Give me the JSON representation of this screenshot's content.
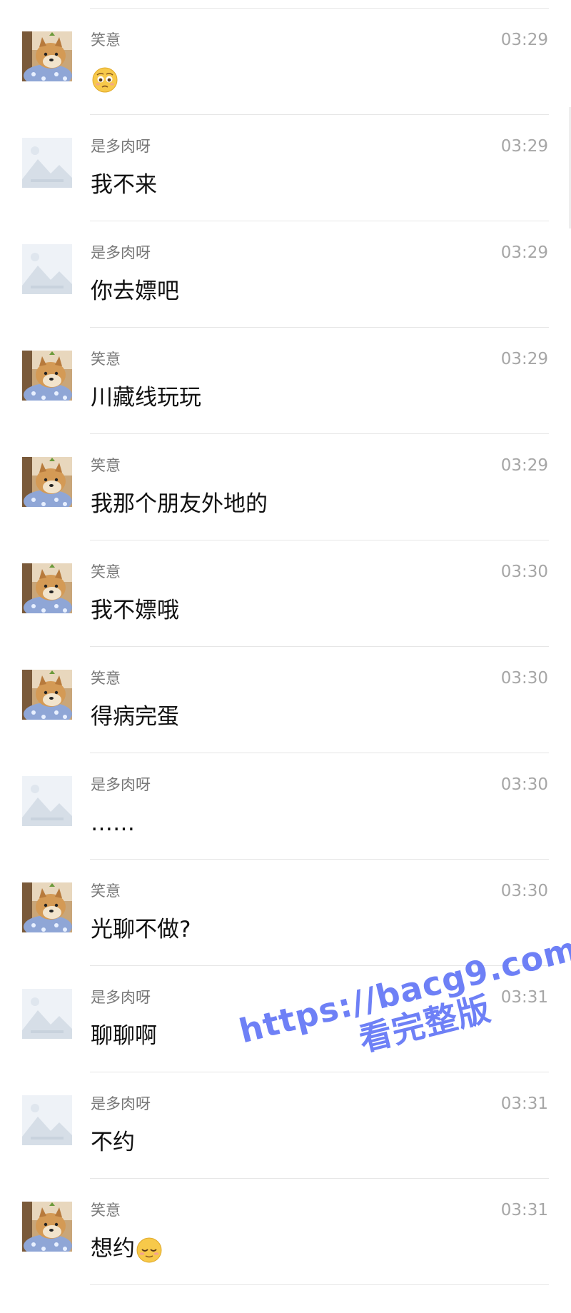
{
  "chat": {
    "messages": [
      {
        "sender": "笑意",
        "time": "03:29",
        "text": "",
        "avatar": "dog",
        "emoji": "pleading-face-icon"
      },
      {
        "sender": "是多肉呀",
        "time": "03:29",
        "text": "我不来",
        "avatar": "placeholder"
      },
      {
        "sender": "是多肉呀",
        "time": "03:29",
        "text": "你去嫖吧",
        "avatar": "placeholder"
      },
      {
        "sender": "笑意",
        "time": "03:29",
        "text": "川藏线玩玩",
        "avatar": "dog"
      },
      {
        "sender": "笑意",
        "time": "03:29",
        "text": "我那个朋友外地的",
        "avatar": "dog"
      },
      {
        "sender": "笑意",
        "time": "03:30",
        "text": "我不嫖哦",
        "avatar": "dog"
      },
      {
        "sender": "笑意",
        "time": "03:30",
        "text": "得病完蛋",
        "avatar": "dog"
      },
      {
        "sender": "是多肉呀",
        "time": "03:30",
        "text": "……",
        "avatar": "placeholder"
      },
      {
        "sender": "笑意",
        "time": "03:30",
        "text": "光聊不做?",
        "avatar": "dog"
      },
      {
        "sender": "是多肉呀",
        "time": "03:31",
        "text": "聊聊啊",
        "avatar": "placeholder"
      },
      {
        "sender": "是多肉呀",
        "time": "03:31",
        "text": "不约",
        "avatar": "placeholder"
      },
      {
        "sender": "笑意",
        "time": "03:31",
        "text": "想约",
        "avatar": "dog",
        "emoji": "relieved-face-icon"
      }
    ]
  },
  "watermark": {
    "line1": "https://bacg9.com",
    "line2": "看完整版",
    "color": "#5b6ff5"
  },
  "colors": {
    "name": "#777777",
    "time": "#a6a6a6",
    "text": "#111111",
    "separator": "#e6e6e6"
  }
}
